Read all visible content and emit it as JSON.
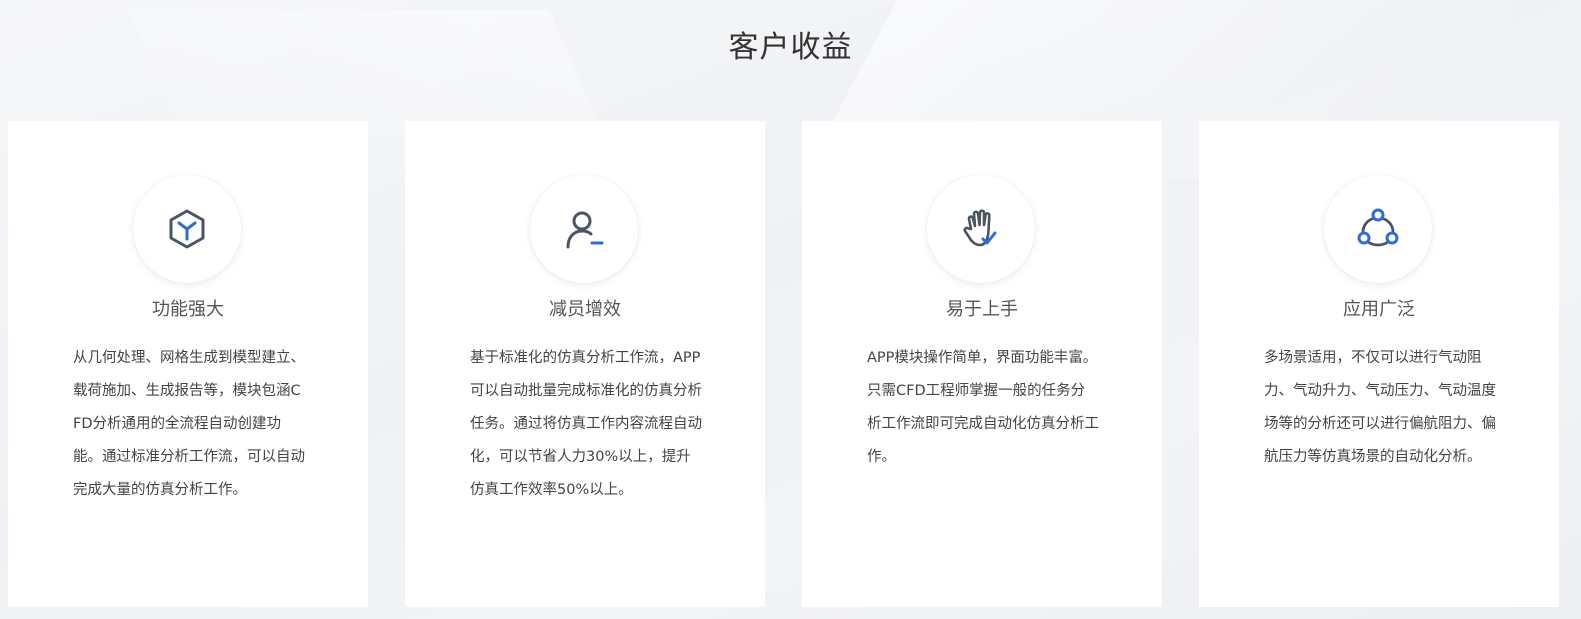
{
  "section": {
    "title": "客户收益"
  },
  "cards": [
    {
      "icon": "cube-icon",
      "title": "功能强大",
      "desc": "从几何处理、网格生成到模型建立、载荷施加、生成报告等，模块包涵CFD分析通用的全流程自动创建功能。通过标准分析工作流，可以自动完成大量的仿真分析工作。"
    },
    {
      "icon": "user-minus-icon",
      "title": "减员增效",
      "desc": "基于标准化的仿真分析工作流，APP可以自动批量完成标准化的仿真分析任务。通过将仿真工作内容流程自动化，可以节省人力30%以上，提升仿真工作效率50%以上。"
    },
    {
      "icon": "hand-icon",
      "title": "易于上手",
      "desc": "APP模块操作简单，界面功能丰富。只需CFD工程师掌握一般的任务分析工作流即可完成自动化仿真分析工作。"
    },
    {
      "icon": "network-icon",
      "title": "应用广泛",
      "desc": "多场景适用，不仅可以进行气动阻力、气动升力、气动压力、气动温度场等的分析还可以进行偏航阻力、偏航压力等仿真场景的自动化分析。"
    }
  ],
  "colors": {
    "accent": "#2b6de0",
    "icon_dark": "#4a5563",
    "title": "#333333",
    "text": "#444444"
  }
}
